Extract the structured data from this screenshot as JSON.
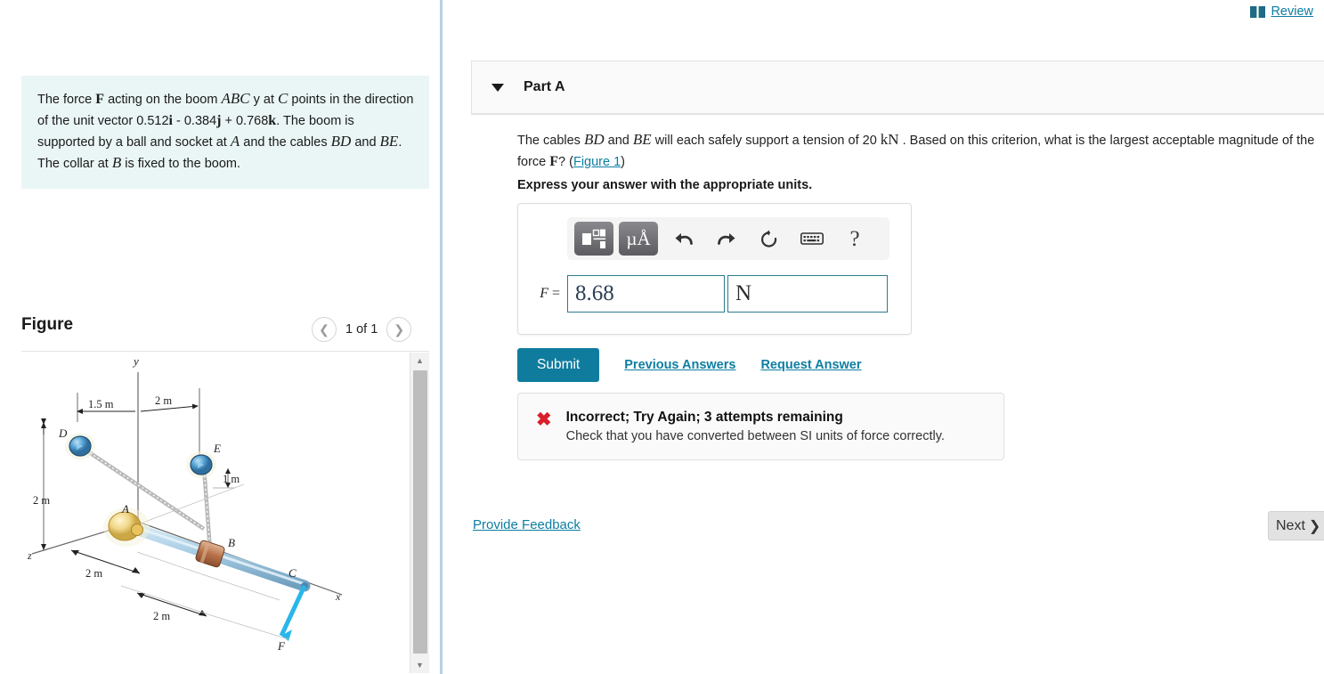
{
  "header": {
    "review_label": "Review",
    "book_icon": "book-icon"
  },
  "left_panel": {
    "problem": {
      "line1_a": "The force ",
      "line1_F": "F",
      "line1_b": " acting on the boom ",
      "line1_ABC": "ABC",
      "line1_c": " y at ",
      "line1_C": "C",
      "line1_d": " points in the direction of the unit vector 0.512",
      "i": "i",
      "minus": " - 0.384",
      "j": "j",
      "plus": " + 0.768",
      "k": "k",
      "line3_a": ". The boom is supported by a ball and socket at ",
      "A": "A",
      "line3_b": " and the cables ",
      "BD": "BD",
      "line3_c": " and ",
      "BE": "BE",
      "line3_d": ". The collar at ",
      "B": "B",
      "line3_e": " is fixed to the boom."
    },
    "figure": {
      "title": "Figure",
      "counter": "1 of 1",
      "prev_icon": "chevron-left-icon",
      "next_icon": "chevron-right-icon",
      "labels": {
        "axis_y": "y",
        "axis_x": "x",
        "axis_z": "z",
        "point_A": "A",
        "point_B": "B",
        "point_C": "C",
        "point_D": "D",
        "point_E": "E",
        "force_F": "F",
        "dim_1_5m": "1.5 m",
        "dim_2m_top": "2 m",
        "dim_1m": "1 m",
        "dim_2m_left": "2 m",
        "dim_2m_lower1": "2 m",
        "dim_2m_lower2": "2 m"
      }
    }
  },
  "main": {
    "part": {
      "label": "Part A",
      "caret_icon": "caret-down-icon"
    },
    "question": {
      "a": "The cables ",
      "BD": "BD",
      "b": " and ",
      "BE": "BE",
      "c": " will each safely support a tension of 20 ",
      "kN": "kN",
      "d": " . Based on this criterion, what is the largest acceptable magnitude of the force ",
      "F": "F",
      "e": "? (",
      "figure_link": "Figure 1",
      "f": ")"
    },
    "express_note": "Express your answer with the appropriate units.",
    "answer": {
      "label_F": "F",
      "equals": "=",
      "value": "8.68",
      "value_placeholder": "",
      "units": "N",
      "units_placeholder": "",
      "toolbar": {
        "template_icon": "math-template-icon",
        "units_icon": "micro-angstrom-units-icon",
        "units_label": "µÅ",
        "undo_icon": "undo-icon",
        "redo_icon": "redo-icon",
        "reset_icon": "reset-icon",
        "keyboard_icon": "keyboard-icon",
        "help_icon": "help-icon",
        "help_label": "?"
      }
    },
    "actions": {
      "submit_label": "Submit",
      "previous_answers_label": "Previous Answers",
      "request_answer_label": "Request Answer"
    },
    "feedback": {
      "icon": "x-mark-icon",
      "icon_glyph": "✖",
      "title": "Incorrect; Try Again; 3 attempts remaining",
      "detail": "Check that you have converted between SI units of force correctly."
    },
    "footer": {
      "provide_feedback_label": "Provide Feedback",
      "next_label": "Next",
      "next_icon": "chevron-right-icon",
      "next_glyph": "❯"
    }
  },
  "colors": {
    "accent_teal": "#0d7ea3",
    "submit_bg": "#0f7c9e",
    "problem_bg": "#eaf6f5",
    "error_red": "#d9202a",
    "divider_blue": "#b9d2e2"
  }
}
